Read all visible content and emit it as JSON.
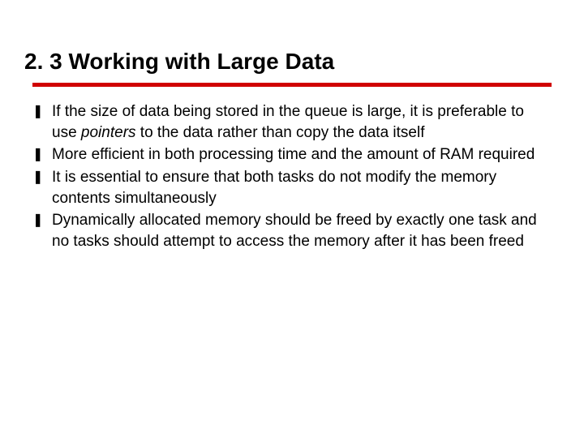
{
  "title": "2. 3 Working with Large Data",
  "bullets": [
    {
      "pre": "If the size of data being stored in the queue is large, it is preferable to use ",
      "em": "pointers",
      "post": " to the data rather than copy the data itself"
    },
    {
      "pre": "More efficient in both processing time and the amount of RAM required",
      "em": "",
      "post": ""
    },
    {
      "pre": "It is essential to ensure that both tasks do not modify the memory contents simultaneously",
      "em": "",
      "post": ""
    },
    {
      "pre": "Dynamically allocated memory should be freed by exactly one task and no tasks should attempt to access the memory after it has been freed",
      "em": "",
      "post": ""
    }
  ],
  "marker": "❚"
}
